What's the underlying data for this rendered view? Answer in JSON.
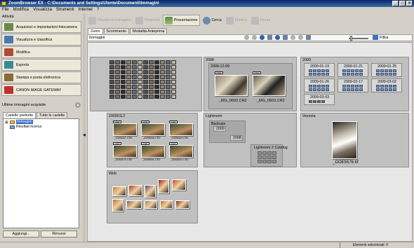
{
  "window": {
    "title": "ZoomBrowser EX - C:\\Documents and Settings\\Utente\\Documenti\\Immagini"
  },
  "menu": [
    "File",
    "Modifica",
    "Visualizza",
    "Strumenti",
    "Internet",
    "?"
  ],
  "activity": {
    "title": "Attività",
    "tasks": [
      {
        "label": "Acquisisci e impostazioni fotocamera",
        "color": "#6a8a4a"
      },
      {
        "label": "Visualizza e classifica",
        "color": "#4a7ab0"
      },
      {
        "label": "Modifica",
        "color": "#b04a3a"
      },
      {
        "label": "Esporta",
        "color": "#3a8a9a"
      },
      {
        "label": "Stampa e posta elettronica",
        "color": "#8a6a3a"
      },
      {
        "label": "CANON iMAGE GATEWAY",
        "color": "#c03030"
      }
    ]
  },
  "recent": {
    "title": "Ultime immagini acquisite"
  },
  "folder_tabs": [
    "Cartelle preferite",
    "Tutte le cartelle"
  ],
  "tree": {
    "root": "Immagini",
    "child": "Risultati ricerca"
  },
  "left_buttons": {
    "add": "Aggiungi...",
    "remove": "Rimuovi"
  },
  "toolbar": {
    "view_image": "Visualizza immagine",
    "properties": "Proprietà",
    "slideshow": "Presentazione",
    "search": "Cerca",
    "delete": "Elimina",
    "rotate": "Ruota"
  },
  "view_tabs": [
    "Zoom",
    "Scorrimento",
    "Modalità Anteprima"
  ],
  "content_header": "Immagini",
  "filter_label": "Filtra",
  "groups": {
    "g2008": {
      "name": "2008",
      "sub": "2008-12-09",
      "files": [
        "_MG_0602.CR2",
        "_MG_0603.CR2"
      ]
    },
    "g2009": {
      "name": "2009",
      "subs": [
        "2009-01-19",
        "2009-01-21",
        "2009-01-25",
        "2009-01-26",
        "2009-02-17",
        "2009-03-02",
        "2009-03-03"
      ]
    },
    "g20090112": {
      "name": "20090112",
      "files": [
        "_0085567.CR2",
        "_0085568.CR2",
        "_0085569.CR2",
        "_0085570.CR2",
        "_0085591.CR2",
        "_0085592.CR2"
      ]
    },
    "lightroom": {
      "name": "Lightroom",
      "backups": "Backups",
      "b2009": "2009",
      "b2008": "2008",
      "catalog": "Lightroom 2 Catalog"
    },
    "vezzola": {
      "name": "Vezzola",
      "file": "_OOE5576.tif"
    },
    "web": {
      "name": "Web"
    }
  },
  "status": "Elementi selezionati: 0"
}
